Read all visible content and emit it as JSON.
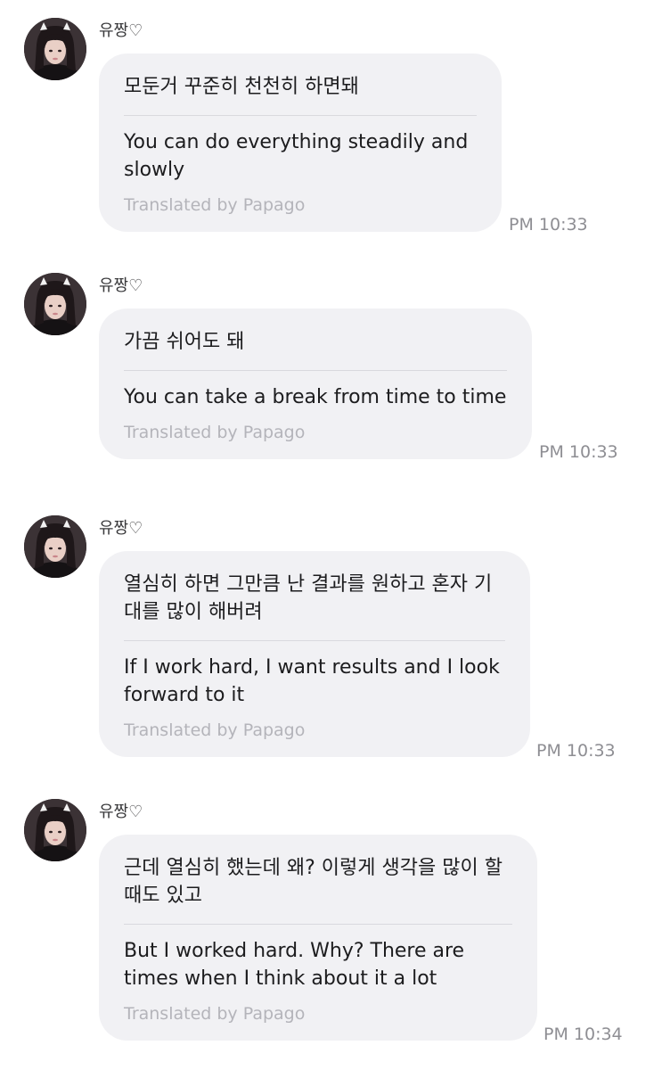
{
  "messages": [
    {
      "sender": "유짱♡",
      "original": "모둔거 꾸준히 천천히 하면돼",
      "translation": "You can do everything steadily and slowly",
      "credit": "Translated by Papago",
      "time": "PM 10:33"
    },
    {
      "sender": "유짱♡",
      "original": "가끔 쉬어도 돼",
      "translation": "You can take a break from time to time",
      "credit": "Translated by Papago",
      "time": "PM 10:33"
    },
    {
      "sender": "유짱♡",
      "original": "열심히 하면 그만큼 난 결과를 원하고 혼자 기대를 많이 해버려",
      "translation": "If I work hard, I want results and I look forward to it",
      "credit": "Translated by Papago",
      "time": "PM 10:33"
    },
    {
      "sender": "유짱♡",
      "original": "근데 열심히 했는데 왜? 이렇게 생각을 많이 할 때도 있고",
      "translation": "But I worked hard. Why? There are times when I think about it a lot",
      "credit": "Translated by Papago",
      "time": "PM 10:34"
    }
  ]
}
